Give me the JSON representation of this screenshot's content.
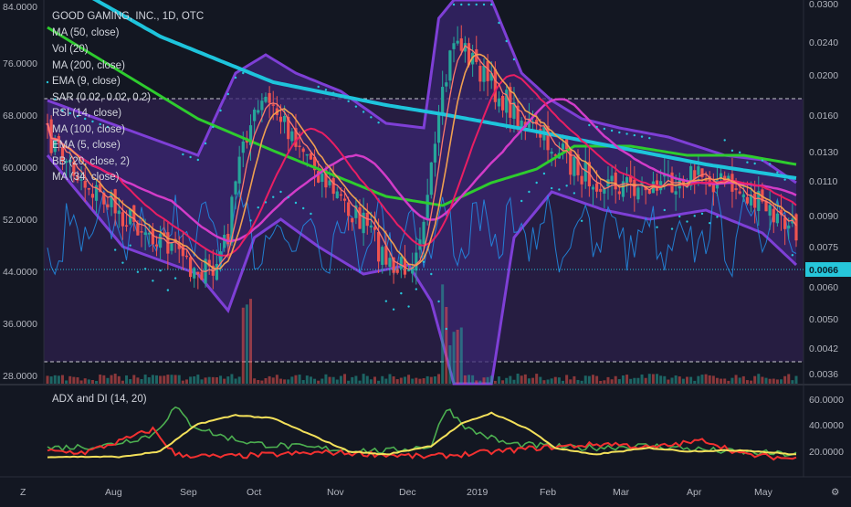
{
  "header": {
    "title": "GOOD GAMING, INC., 1D, OTC",
    "indicators": [
      "MA (50, close)",
      "Vol (20)",
      "MA (200, close)",
      "EMA (9, close)",
      "SAR (0.02, 0.02, 0.2)",
      "RSI (14, close)",
      "MA (100, close)",
      "EMA (5, close)",
      "BB (20, close, 2)",
      "MA (34, close)"
    ]
  },
  "sub_pane": {
    "title": "ADX and DI (14, 20)"
  },
  "colors": {
    "background": "#131722",
    "rsi_band": "#2a1f47",
    "bb_fill": "#3a2670",
    "bb_line": "#7e3fd6",
    "up_candle": "#26a69a",
    "down_candle": "#ef5350",
    "ma50": "#e91e63",
    "ma100": "#2ecc2e",
    "ma200": "#1ec4dc",
    "ema9": "#f0a050",
    "ema5": "#ff7a6a",
    "ma34": "#d23cc8",
    "rsi": "#2196f3",
    "sar": "#26c6da",
    "adx": "#f3e05a",
    "di_plus": "#4caf50",
    "di_minus": "#f23030"
  },
  "chart_data": [
    {
      "type": "candlestick",
      "name": "price",
      "y_scale": "log",
      "y_labels_right": [
        "0.0300",
        "0.0240",
        "0.0200",
        "0.0160",
        "0.0130",
        "0.0110",
        "0.0090",
        "0.0075",
        "0.0066",
        "0.0060",
        "0.0050",
        "0.0042",
        "0.0036"
      ],
      "y_labels_left": [
        "84.0000",
        "76.0000",
        "68.0000",
        "60.0000",
        "52.0000",
        "44.0000",
        "36.0000",
        "28.0000"
      ],
      "last_price": "0.0066",
      "x_labels": [
        "Aug",
        "Sep",
        "Oct",
        "Nov",
        "Dec",
        "2019",
        "Feb",
        "Mar",
        "Apr",
        "May"
      ],
      "overlays": [
        "MA 50",
        "MA 100",
        "MA 200",
        "EMA 9",
        "EMA 5",
        "MA 34",
        "BB 20",
        "SAR",
        "RSI 14",
        "Volume"
      ]
    },
    {
      "type": "line",
      "name": "ADX and DI",
      "y_labels": [
        "60.0000",
        "40.0000",
        "20.0000"
      ],
      "ylim": [
        0,
        70
      ],
      "series": [
        "ADX",
        "DI+",
        "DI-"
      ]
    }
  ]
}
